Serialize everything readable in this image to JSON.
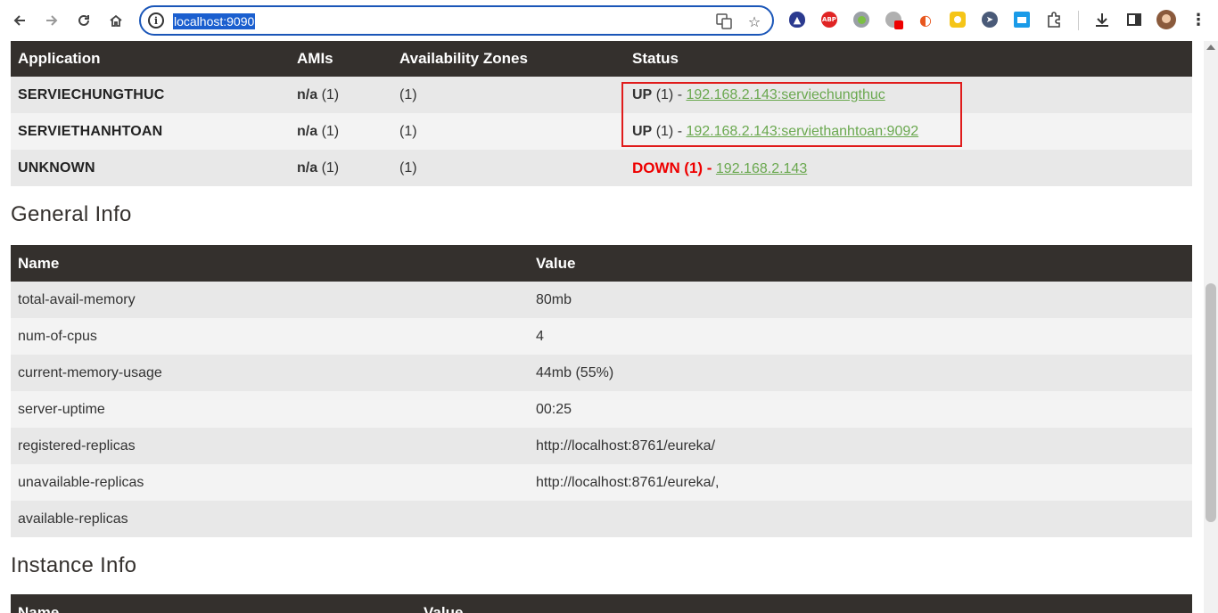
{
  "browser": {
    "url": "localhost:9090"
  },
  "applications": {
    "headers": [
      "Application",
      "AMIs",
      "Availability Zones",
      "Status"
    ],
    "rows": [
      {
        "name": "SERVIECHUNGTHUC",
        "ami_na": "n/a",
        "ami_count": "(1)",
        "zones": "(1)",
        "status_label": "UP",
        "status_count": "(1) -",
        "instance": "192.168.2.143:serviechungthuc",
        "status": "up"
      },
      {
        "name": "SERVIETHANHTOAN",
        "ami_na": "n/a",
        "ami_count": "(1)",
        "zones": "(1)",
        "status_label": "UP",
        "status_count": "(1) -",
        "instance": "192.168.2.143:serviethanhtoan:9092",
        "status": "up"
      },
      {
        "name": "UNKNOWN",
        "ami_na": "n/a",
        "ami_count": "(1)",
        "zones": "(1)",
        "status_label": "DOWN",
        "status_count": "(1) -",
        "instance": "192.168.2.143",
        "status": "down"
      }
    ]
  },
  "general_info": {
    "title": "General Info",
    "headers": [
      "Name",
      "Value"
    ],
    "rows": [
      {
        "name": "total-avail-memory",
        "value": "80mb"
      },
      {
        "name": "num-of-cpus",
        "value": "4"
      },
      {
        "name": "current-memory-usage",
        "value": "44mb (55%)"
      },
      {
        "name": "server-uptime",
        "value": "00:25"
      },
      {
        "name": "registered-replicas",
        "value": "http://localhost:8761/eureka/"
      },
      {
        "name": "unavailable-replicas",
        "value": "http://localhost:8761/eureka/,"
      },
      {
        "name": "available-replicas",
        "value": ""
      }
    ]
  },
  "instance_info": {
    "title": "Instance Info",
    "headers": [
      "Name",
      "Value"
    ]
  },
  "colors": {
    "header_bg": "#34302d",
    "link": "#6aa84f",
    "down": "#ee0000",
    "highlight": "#e01b1b",
    "omnibox_border": "#1a56b8"
  },
  "icons": [
    "back-arrow-icon",
    "forward-arrow-icon",
    "reload-icon",
    "home-icon",
    "site-info-icon",
    "translate-icon",
    "bookmark-star-icon",
    "extensions-puzzle-icon",
    "download-icon",
    "side-panel-icon",
    "profile-avatar",
    "more-menu-icon"
  ]
}
